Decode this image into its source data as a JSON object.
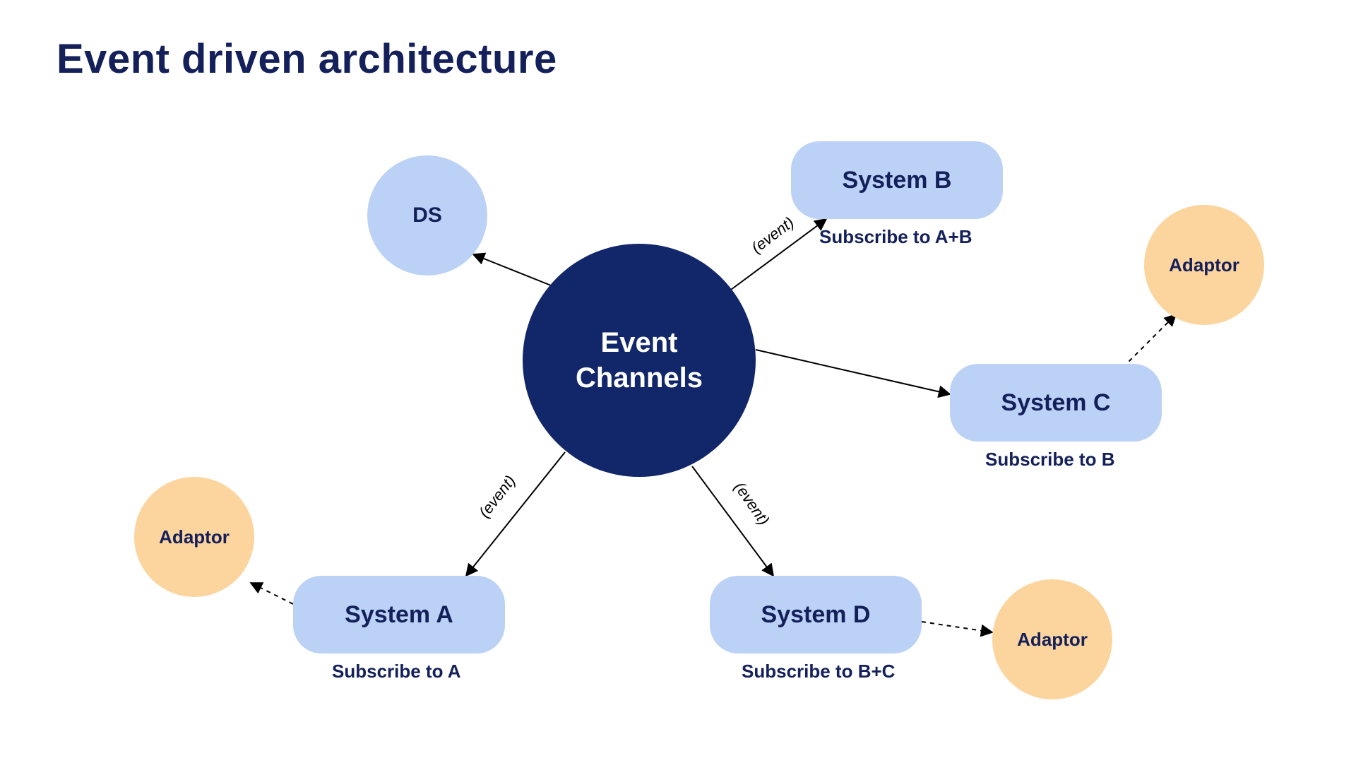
{
  "title": "Event driven architecture",
  "hub": {
    "label": "Event\nChannels"
  },
  "nodes": {
    "ds": {
      "label": "DS"
    },
    "systemA": {
      "label": "System A",
      "subscribe": "Subscribe to A"
    },
    "systemB": {
      "label": "System B",
      "subscribe": "Subscribe to A+B"
    },
    "systemC": {
      "label": "System C",
      "subscribe": "Subscribe to B"
    },
    "systemD": {
      "label": "System D",
      "subscribe": "Subscribe to B+C"
    },
    "adaptorA": {
      "label": "Adaptor"
    },
    "adaptorC": {
      "label": "Adaptor"
    },
    "adaptorD": {
      "label": "Adaptor"
    }
  },
  "edge_label": "(event)",
  "colors": {
    "darkblue": "#12266a",
    "lightblue": "#bbd1f6",
    "orange": "#fcd49e",
    "text": "#14205a"
  }
}
